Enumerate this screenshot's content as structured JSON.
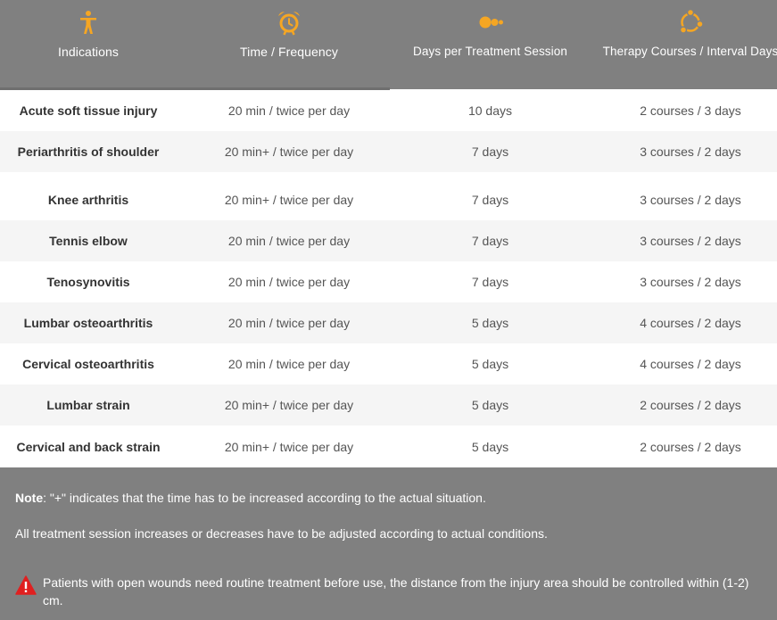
{
  "colors": {
    "header_bg": "#808080",
    "icon_accent": "#f5a623",
    "row_alt_bg": "#f5f5f5",
    "footer_bg": "#808080",
    "warning_red": "#e02020"
  },
  "header": {
    "columns": [
      {
        "label": "Indications",
        "icon": "person-icon"
      },
      {
        "label": "Time / Frequency",
        "icon": "alarm-clock-icon"
      },
      {
        "label": "Days per Treatment Session",
        "icon": "dots-icon"
      },
      {
        "label": "Therapy Courses / Interval Days",
        "icon": "cycle-icon"
      }
    ]
  },
  "rows": [
    {
      "indication": "Acute soft tissue injury",
      "time": "20 min / twice per day",
      "days": "10 days",
      "courses": "2 courses / 3 days"
    },
    {
      "indication": "Periarthritis of shoulder",
      "time": "20 min+ / twice per day",
      "days": "7 days",
      "courses": "3 courses / 2 days"
    },
    {
      "indication": "Knee arthritis",
      "time": "20 min+ / twice per day",
      "days": "7 days",
      "courses": "3 courses / 2 days"
    },
    {
      "indication": "Tennis elbow",
      "time": "20 min / twice per day",
      "days": "7 days",
      "courses": "3 courses / 2 days"
    },
    {
      "indication": "Tenosynovitis",
      "time": "20 min / twice per day",
      "days": "7 days",
      "courses": "3 courses / 2 days"
    },
    {
      "indication": "Lumbar osteoarthritis",
      "time": "20 min / twice per day",
      "days": "5 days",
      "courses": "4 courses / 2 days"
    },
    {
      "indication": "Cervical osteoarthritis",
      "time": "20 min / twice per day",
      "days": "5 days",
      "courses": "4 courses / 2 days"
    },
    {
      "indication": "Lumbar strain",
      "time": "20 min+ / twice per day",
      "days": "5 days",
      "courses": "2 courses / 2 days"
    },
    {
      "indication": "Cervical and back strain",
      "time": "20 min+ / twice per day",
      "days": "5 days",
      "courses": "2 courses / 2 days"
    }
  ],
  "footer": {
    "note_label": "Note",
    "note_text": ":  \"+\" indicates that the time has to be increased according to the actual situation.",
    "note2": "All treatment session increases or decreases have to be adjusted according to actual conditions.",
    "warning_icon": "warning-triangle-icon",
    "warning": "Patients with open wounds need routine treatment before use, the distance from the injury area should be controlled within (1-2) cm."
  }
}
